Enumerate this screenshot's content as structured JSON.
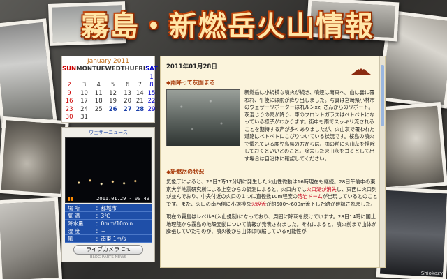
{
  "site_title": "霧島・新燃岳火山情報",
  "calendar": {
    "title": "January 2011",
    "weekdays": [
      "SUN",
      "MON",
      "TUE",
      "WED",
      "THU",
      "FRI",
      "SAT"
    ],
    "rows": [
      [
        "",
        "",
        "",
        "",
        "",
        "",
        "1"
      ],
      [
        "2",
        "3",
        "4",
        "5",
        "6",
        "7",
        "8"
      ],
      [
        "9",
        "10",
        "11",
        "12",
        "13",
        "14",
        "15"
      ],
      [
        "16",
        "17",
        "18",
        "19",
        "20",
        "21",
        "22"
      ],
      [
        "23",
        "24",
        "25",
        "26",
        "27",
        "28",
        "29"
      ],
      [
        "30",
        "31",
        "",
        "",
        "",
        "",
        ""
      ]
    ],
    "linked_days": [
      "26",
      "27",
      "28"
    ]
  },
  "weather_widget": {
    "header": "ウェザーニュース",
    "timestamp": "2011.01.29 - 00:49",
    "rows": [
      {
        "key": "場 所",
        "value": "：都城市"
      },
      {
        "key": "気 温",
        "value": "：3℃"
      },
      {
        "key": "降水量",
        "value": "：0mm/10min"
      },
      {
        "key": "湿 度",
        "value": "：－"
      },
      {
        "key": "風",
        "value": "：南東 1m/s"
      }
    ],
    "live_button": "ライブカメラ Ch.",
    "footer": "BLOG PARTS NEWS"
  },
  "article": {
    "date": "2011年01月28日",
    "section1_title": "◆雨降って灰固まる",
    "section1_text": "新燃岳は小規模な噴火が続き、噴煙は南東へ。山は雲に覆われ、午後には雨が降り出しました。写真は宮崎県小林市のウェザーリポーターはれルンxzJ さんからのリポート。灰混じりの雨が降り、車のフロントガラスはベトベトになっている様子がわかります。街中も雨でスッキリ流されることを期待する声が多くありましたが、火山灰で覆われた道路はベトベトにこびりついている状況です。桜島の噴火で慣れている鹿児島県の方からは、雨の前に火山灰を掃除しておくといいとのこと。除去した火山灰をゴミとして出す場合は自治体に確認してください。",
    "section2_title": "◆新燃岳の状況",
    "section2_text_a": "気象庁によると、26日7時17分頃に発生した火山性微動は16時現在も継続。28日午前中の東京大学地震研究所による上空からの観測によると、火口内では",
    "section2_hl1": "火口湖が消失",
    "section2_text_b": "し、東西に火口列が並んでおり、中央付近の火口の１つに直径数10m程度の",
    "section2_hl2": "溶岩ドーム",
    "section2_text_c": "が出現しているとのことです。また、火口の南西側に小規模な",
    "section2_hl3": "火砕流",
    "section2_text_d": "が約500〜600m流下した跡が確認されました。",
    "section3_text": "現在の霧島はレベル3(入山規制)になっており、周囲に降灰を続けています。28日14時に国土地理院から霧島の地殻変動について情報が発表されました。それによると、噴火前まで山体が膨張していたものが、噴火後から山体は収縮している可能性が"
  },
  "credit": "Shiokazy",
  "colors": {
    "title_fill": "#ffe6a8",
    "title_outline": "#8a2800",
    "panel_bg": "#fbf4dc",
    "section_heading": "#a83a0a",
    "highlight": "#c8001c",
    "weather_table": "#1f4fa8"
  }
}
